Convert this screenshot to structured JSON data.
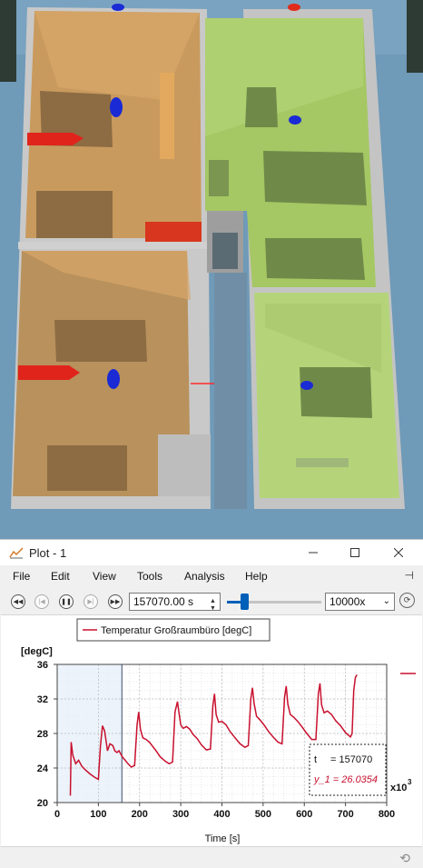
{
  "window": {
    "title": "Plot - 1",
    "minimize_icon": "minimize-icon",
    "maximize_icon": "maximize-icon",
    "close_icon": "close-icon"
  },
  "menu": [
    "File",
    "Edit",
    "View",
    "Tools",
    "Analysis",
    "Help"
  ],
  "toolbar": {
    "time_value": "157070.00 s",
    "speed_value": "10000x",
    "slider_fraction": 0.18
  },
  "legend": {
    "label": "Temperatur Großraumbüro [degC]",
    "color": "#c8102e"
  },
  "cursor_box": {
    "t_label": "t",
    "t_value": "= 157070",
    "y_label": "y_1 = 26.0354"
  },
  "chart_data": {
    "type": "line",
    "ylabel": "[degC]",
    "xlabel": "Time [s]",
    "x_multiplier": "x10",
    "x_multiplier_exp": "3",
    "xlim": [
      0,
      800
    ],
    "ylim": [
      20,
      36
    ],
    "x_ticks": [
      "0",
      "100",
      "200",
      "300",
      "400",
      "500",
      "600",
      "700",
      "800"
    ],
    "y_ticks": [
      "20",
      "24",
      "28",
      "32",
      "36"
    ],
    "grid": true,
    "cursor_x": 157.07,
    "series": [
      {
        "name": "Temperatur Großraumbüro [degC]",
        "color": "#c8102e",
        "x": [
          32,
          34,
          38,
          45,
          52,
          60,
          68,
          80,
          92,
          100,
          105,
          110,
          115,
          118,
          122,
          128,
          135,
          140,
          145,
          150,
          158,
          165,
          172,
          180,
          188,
          194,
          198,
          202,
          208,
          216,
          224,
          232,
          240,
          250,
          262,
          272,
          280,
          286,
          292,
          296,
          300,
          306,
          314,
          322,
          330,
          340,
          350,
          362,
          372,
          378,
          382,
          386,
          392,
          400,
          410,
          420,
          432,
          444,
          456,
          464,
          470,
          474,
          478,
          484,
          492,
          502,
          512,
          524,
          536,
          546,
          552,
          556,
          560,
          566,
          574,
          584,
          594,
          606,
          618,
          628,
          634,
          638,
          642,
          648,
          656,
          666,
          676,
          688,
          700,
          712,
          716,
          720,
          724,
          728
        ],
        "y": [
          20.8,
          27.0,
          25.5,
          24.5,
          24.9,
          24.2,
          23.8,
          23.3,
          22.9,
          22.7,
          26.5,
          28.9,
          28.3,
          27.4,
          26.0,
          26.8,
          26.6,
          26.0,
          25.8,
          26.0,
          25.3,
          24.9,
          24.5,
          24.1,
          24.3,
          29.0,
          30.5,
          28.5,
          27.5,
          27.3,
          27.0,
          26.5,
          26.0,
          25.3,
          24.8,
          24.5,
          24.7,
          30.5,
          31.7,
          30.3,
          29.0,
          28.6,
          28.8,
          28.5,
          27.9,
          27.4,
          26.7,
          26.1,
          26.2,
          31.2,
          32.6,
          30.2,
          29.3,
          29.4,
          29.0,
          28.2,
          27.5,
          26.8,
          26.4,
          26.6,
          32.0,
          33.3,
          31.5,
          30.0,
          29.6,
          29.0,
          28.3,
          27.6,
          27.0,
          26.8,
          32.2,
          33.5,
          31.4,
          30.2,
          29.9,
          29.4,
          28.8,
          28.0,
          27.3,
          27.3,
          32.6,
          33.8,
          31.3,
          30.4,
          30.6,
          30.2,
          29.5,
          28.9,
          28.1,
          27.6,
          28.0,
          33.0,
          34.5,
          34.8
        ]
      }
    ]
  }
}
